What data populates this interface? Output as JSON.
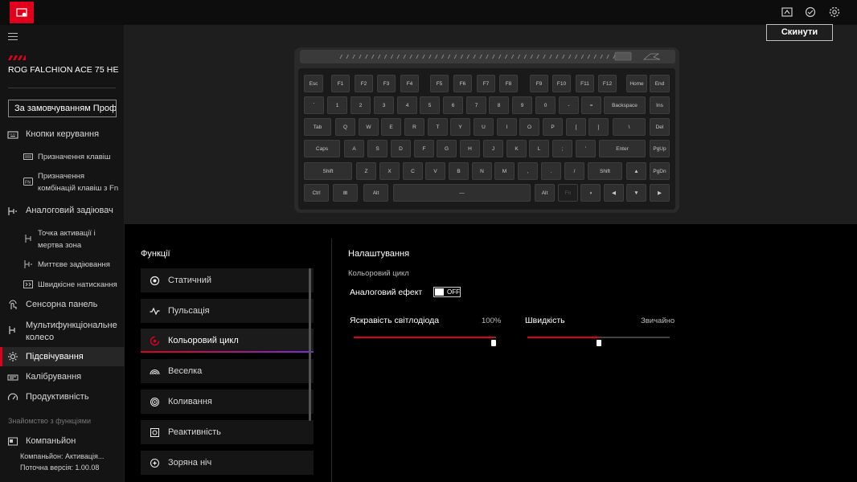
{
  "app": {
    "device_name": "ROG FALCHION ACE 75 HE",
    "profile": "За замовчуванням Профі...",
    "reset_label": "Скинути"
  },
  "sidebar": {
    "items": [
      {
        "label": "Кнопки керування",
        "icon": "keyboard-icon"
      },
      {
        "label": "Призначення клавіш",
        "icon": "keyboard-small-icon",
        "sub": true
      },
      {
        "label": "Призначення комбінацій клавіш з Fn",
        "icon": "fn-key-icon",
        "sub": true
      },
      {
        "label": "Аналоговий задіювач",
        "icon": "analog-icon"
      },
      {
        "label": "Точка активації і мертва зона",
        "icon": "actuation-icon",
        "sub": true
      },
      {
        "label": "Миттєве задіювання",
        "icon": "rapid-icon",
        "sub": true
      },
      {
        "label": "Швидкісне натискання",
        "icon": "speed-tap-icon",
        "sub": true
      },
      {
        "label": "Сенсорна панель",
        "icon": "touch-panel-icon"
      },
      {
        "label": "Мультифункціональне колесо",
        "icon": "wheel-icon"
      },
      {
        "label": "Підсвічування",
        "icon": "lighting-icon",
        "active": true
      },
      {
        "label": "Калібрування",
        "icon": "calibration-icon"
      },
      {
        "label": "Продуктивність",
        "icon": "performance-icon"
      }
    ],
    "section_label": "Знайомство з функціями",
    "companion": {
      "label": "Компаньйон",
      "status": "Компаньйон:  Активація...",
      "version": "Поточна версія: 1.00.08"
    }
  },
  "keyboard": {
    "rows": [
      [
        "Esc",
        "F1",
        "F2",
        "F3",
        "F4",
        "F5",
        "F6",
        "F7",
        "F8",
        "F9",
        "F10",
        "F11",
        "F12",
        "Home",
        "End"
      ],
      [
        "`",
        "1",
        "2",
        "3",
        "4",
        "5",
        "6",
        "7",
        "8",
        "9",
        "0",
        "-",
        "=",
        "Backspace",
        "Ins"
      ],
      [
        "Tab",
        "Q",
        "W",
        "E",
        "R",
        "T",
        "Y",
        "U",
        "I",
        "O",
        "P",
        "[",
        "]",
        "\\",
        "Del"
      ],
      [
        "Caps",
        "A",
        "S",
        "D",
        "F",
        "G",
        "H",
        "J",
        "K",
        "L",
        ";",
        "'",
        "Enter",
        "PgUp"
      ],
      [
        "Shift",
        "Z",
        "X",
        "C",
        "V",
        "B",
        "N",
        "M",
        ",",
        ".",
        "/",
        "Shift",
        "▲",
        "PgDn"
      ],
      [
        "Ctrl",
        "⊞",
        "Alt",
        "—",
        "Alt",
        "Fn",
        "◑",
        "◀",
        "▼",
        "▶"
      ]
    ]
  },
  "functions": {
    "title": "Функції",
    "items": [
      {
        "label": "Статичний",
        "icon": "static-icon"
      },
      {
        "label": "Пульсація",
        "icon": "pulse-icon"
      },
      {
        "label": "Кольоровий цикл",
        "icon": "color-cycle-icon",
        "active": true
      },
      {
        "label": "Веселка",
        "icon": "rainbow-icon"
      },
      {
        "label": "Коливання",
        "icon": "ripple-icon"
      },
      {
        "label": "Реактивність",
        "icon": "reactive-icon"
      },
      {
        "label": "Зоряна ніч",
        "icon": "starry-night-icon"
      }
    ]
  },
  "settings": {
    "title": "Налаштування",
    "subtitle": "Кольоровий цикл",
    "analog_effect_label": "Аналоговий ефект",
    "analog_effect_state": "OFF",
    "brightness_label": "Яскравість світлодіода",
    "brightness_value": "100%",
    "brightness_fraction": 1.0,
    "speed_label": "Швидкість",
    "speed_value": "Звичайно",
    "speed_fraction": 0.5
  },
  "colors": {
    "accent": "#e0001b",
    "accent_gradient_end": "#7a2bd9"
  }
}
